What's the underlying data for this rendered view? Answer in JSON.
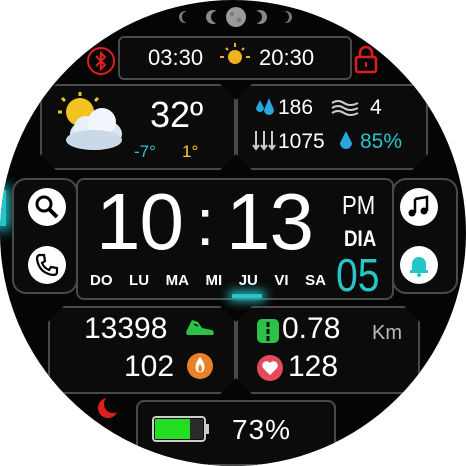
{
  "status": {
    "sunrise": "03:30",
    "sunset": "20:30"
  },
  "weather": {
    "temp": "32º",
    "low": "-7°",
    "high": "1°"
  },
  "env": {
    "humidity_top": "186",
    "wind": "4",
    "pressure": "1075",
    "humidity": "85%"
  },
  "time": {
    "hour": "10",
    "colon": ":",
    "minute": "13",
    "ampm": "PM",
    "day_label": "DIA",
    "day_number": "05"
  },
  "weekdays": [
    "DO",
    "LU",
    "MA",
    "MI",
    "JU",
    "VI",
    "SA"
  ],
  "activity": {
    "steps": "13398",
    "calories": "102",
    "distance": "0.78",
    "distance_unit": "Km",
    "heart_rate": "128"
  },
  "battery": {
    "percent_text": "73%",
    "level": 0.73
  },
  "colors": {
    "accent_cyan": "#27c4c8",
    "accent_yellow": "#f2d21f",
    "alert_red": "#e01e1e",
    "steps_green": "#2cc24a",
    "calories_orange": "#e8822a",
    "heart_red": "#e54a5a"
  },
  "icons": {
    "bluetooth": "bluetooth-icon",
    "lock": "lock-icon",
    "sun": "sun-icon",
    "weather": "partly-cloudy-icon",
    "search": "search-icon",
    "phone": "phone-icon",
    "music": "music-note-icon",
    "bell": "bell-icon",
    "moon": "moon-icon",
    "battery": "battery-icon"
  }
}
